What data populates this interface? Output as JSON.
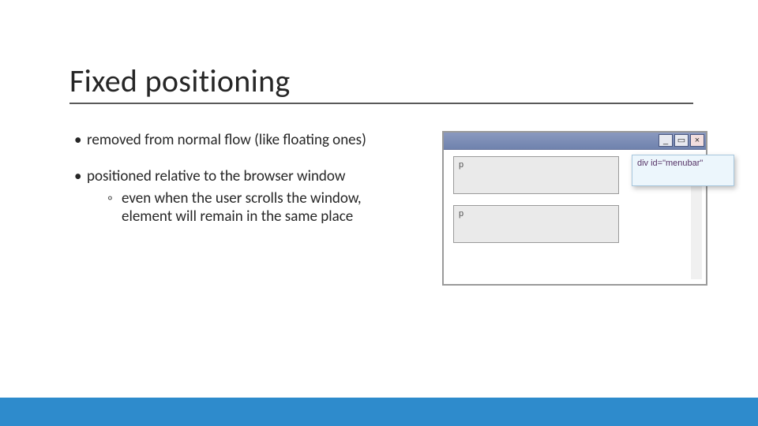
{
  "title": "Fixed positioning",
  "bullets": {
    "b1": "removed from normal flow (like floating ones)",
    "b2": "positioned relative to the browser window",
    "b2_sub": "even when the user scrolls the window, element will remain in the same place"
  },
  "diagram": {
    "window_buttons": {
      "min": "_",
      "max": "▭",
      "close": "×"
    },
    "p_label_1": "p",
    "p_label_2": "p",
    "menubar_label": "div id=\"menubar\""
  }
}
